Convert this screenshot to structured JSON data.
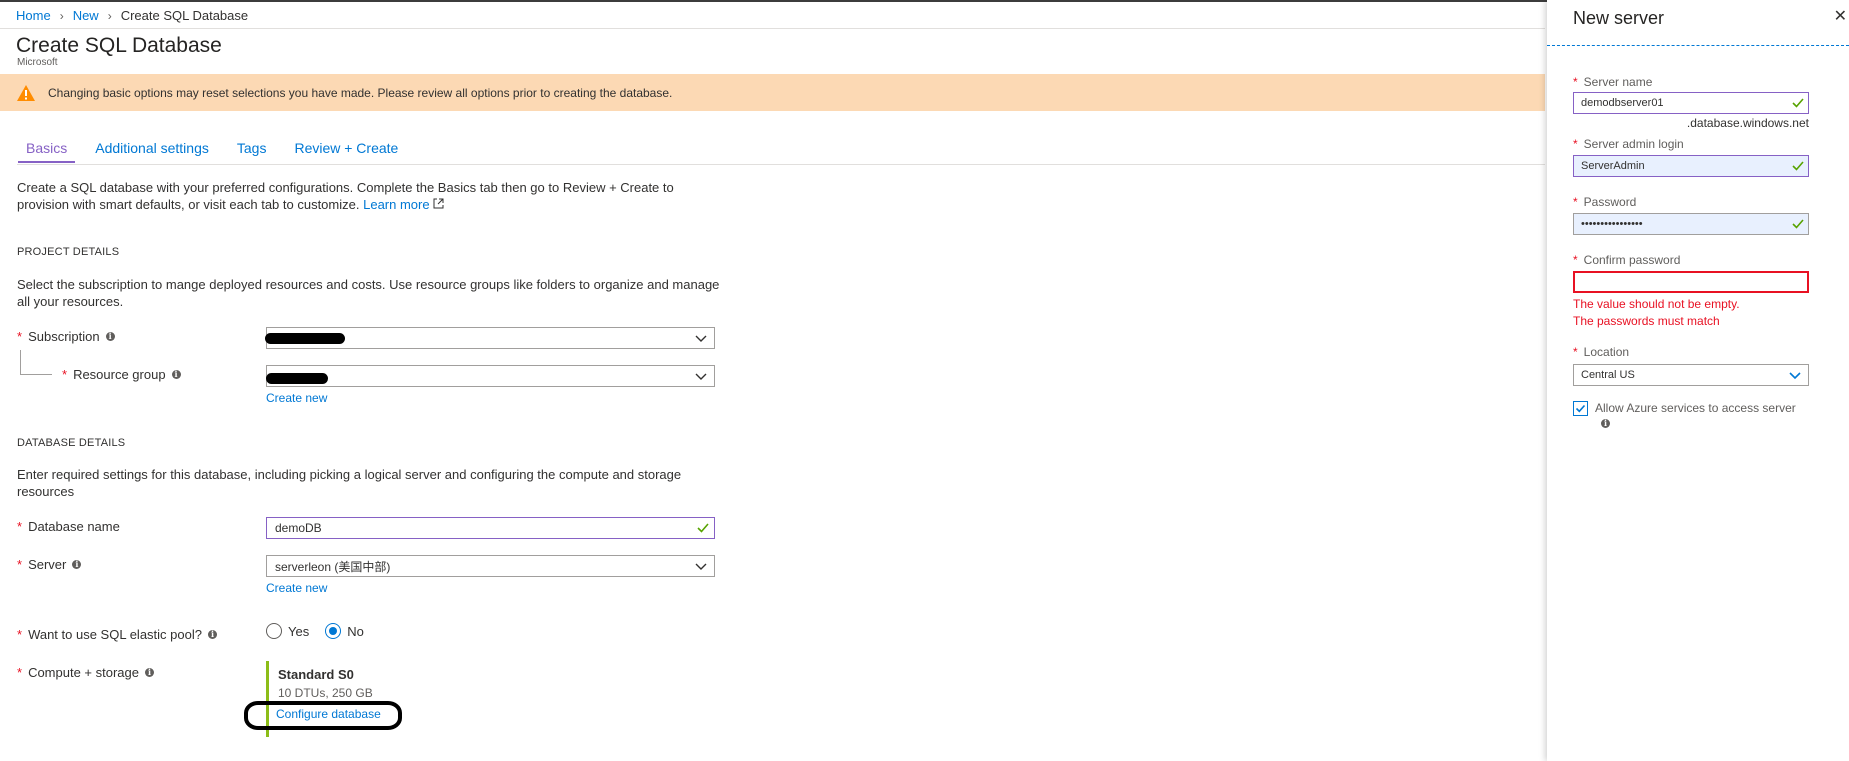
{
  "breadcrumb": {
    "home": "Home",
    "new": "New",
    "current": "Create SQL Database"
  },
  "page": {
    "title": "Create SQL Database",
    "subtitle": "Microsoft"
  },
  "banner": {
    "text": "Changing basic options may reset selections you have made. Please review all options prior to creating the database."
  },
  "tabs": [
    "Basics",
    "Additional settings",
    "Tags",
    "Review + Create"
  ],
  "intro": {
    "text": "Create a SQL database with your preferred configurations. Complete the Basics tab then go to Review + Create to provision with smart defaults, or visit each tab to customize.",
    "learn_more": "Learn more"
  },
  "project": {
    "heading": "PROJECT DETAILS",
    "description": "Select the subscription to mange deployed resources and costs. Use resource groups like folders to organize and manage all your resources.",
    "subscription_label": "Subscription",
    "resource_group_label": "Resource group",
    "create_new": "Create new"
  },
  "database": {
    "heading": "DATABASE DETAILS",
    "description": "Enter required settings for this database, including picking a logical server and configuring the compute and storage resources",
    "name_label": "Database name",
    "name_value": "demoDB",
    "server_label": "Server",
    "server_value": "serverleon (美国中部)",
    "create_new": "Create new",
    "elastic_label": "Want to use SQL elastic pool?",
    "elastic_yes": "Yes",
    "elastic_no": "No",
    "elastic_selected": "No",
    "compute_label": "Compute + storage",
    "compute_tier": "Standard S0",
    "compute_detail": "10 DTUs, 250 GB",
    "configure_link": "Configure database"
  },
  "panel": {
    "title": "New server",
    "close": "✕",
    "server_name_label": "Server name",
    "server_name_value": "demodbserver01",
    "server_name_suffix": ".database.windows.net",
    "admin_login_label": "Server admin login",
    "admin_login_value": "ServerAdmin",
    "password_label": "Password",
    "password_value": "••••••••••••••••",
    "confirm_label": "Confirm password",
    "confirm_value": "",
    "error_empty": "The value should not be empty.",
    "error_match": "The passwords must match",
    "location_label": "Location",
    "location_value": "Central US",
    "allow_azure_label": "Allow Azure services to access server",
    "allow_azure_checked": true
  },
  "colors": {
    "link": "#0078d4",
    "accent_purple": "#8661c5",
    "warning_bg": "#fcd9b4",
    "error": "#e81123",
    "valid_check": "#57a300",
    "compute_bar": "#8cbd18"
  }
}
